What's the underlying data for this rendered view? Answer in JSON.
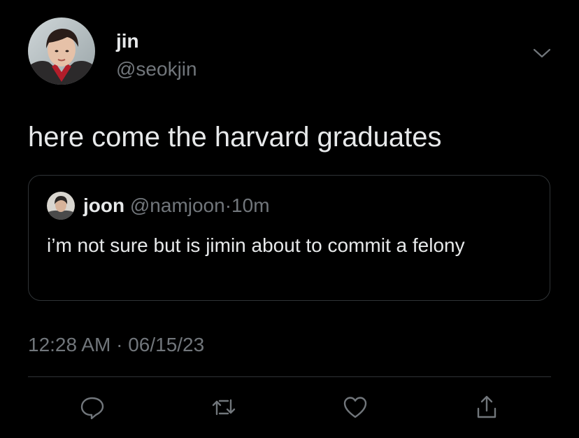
{
  "tweet": {
    "author": {
      "display_name": "jin",
      "handle": "@seokjin",
      "avatar_icon": "profile-photo"
    },
    "text": "here come the harvard graduates",
    "menu_icon": "chevron-down-icon"
  },
  "quote": {
    "author": {
      "display_name": "joon",
      "handle": "@namjoon",
      "avatar_icon": "profile-photo"
    },
    "separator": "·",
    "time": "10m",
    "text": "i’m not sure but is jimin about to commit a felony"
  },
  "meta": {
    "time": "12:28 AM",
    "separator": "·",
    "date": "06/15/23"
  },
  "actions": [
    {
      "name": "reply",
      "icon": "reply-icon"
    },
    {
      "name": "retweet",
      "icon": "retweet-icon"
    },
    {
      "name": "like",
      "icon": "heart-icon"
    },
    {
      "name": "share",
      "icon": "share-icon"
    }
  ],
  "colors": {
    "background": "#000000",
    "primary_text": "#e7e9ea",
    "secondary_text": "#71767b",
    "border": "#2f3336"
  }
}
